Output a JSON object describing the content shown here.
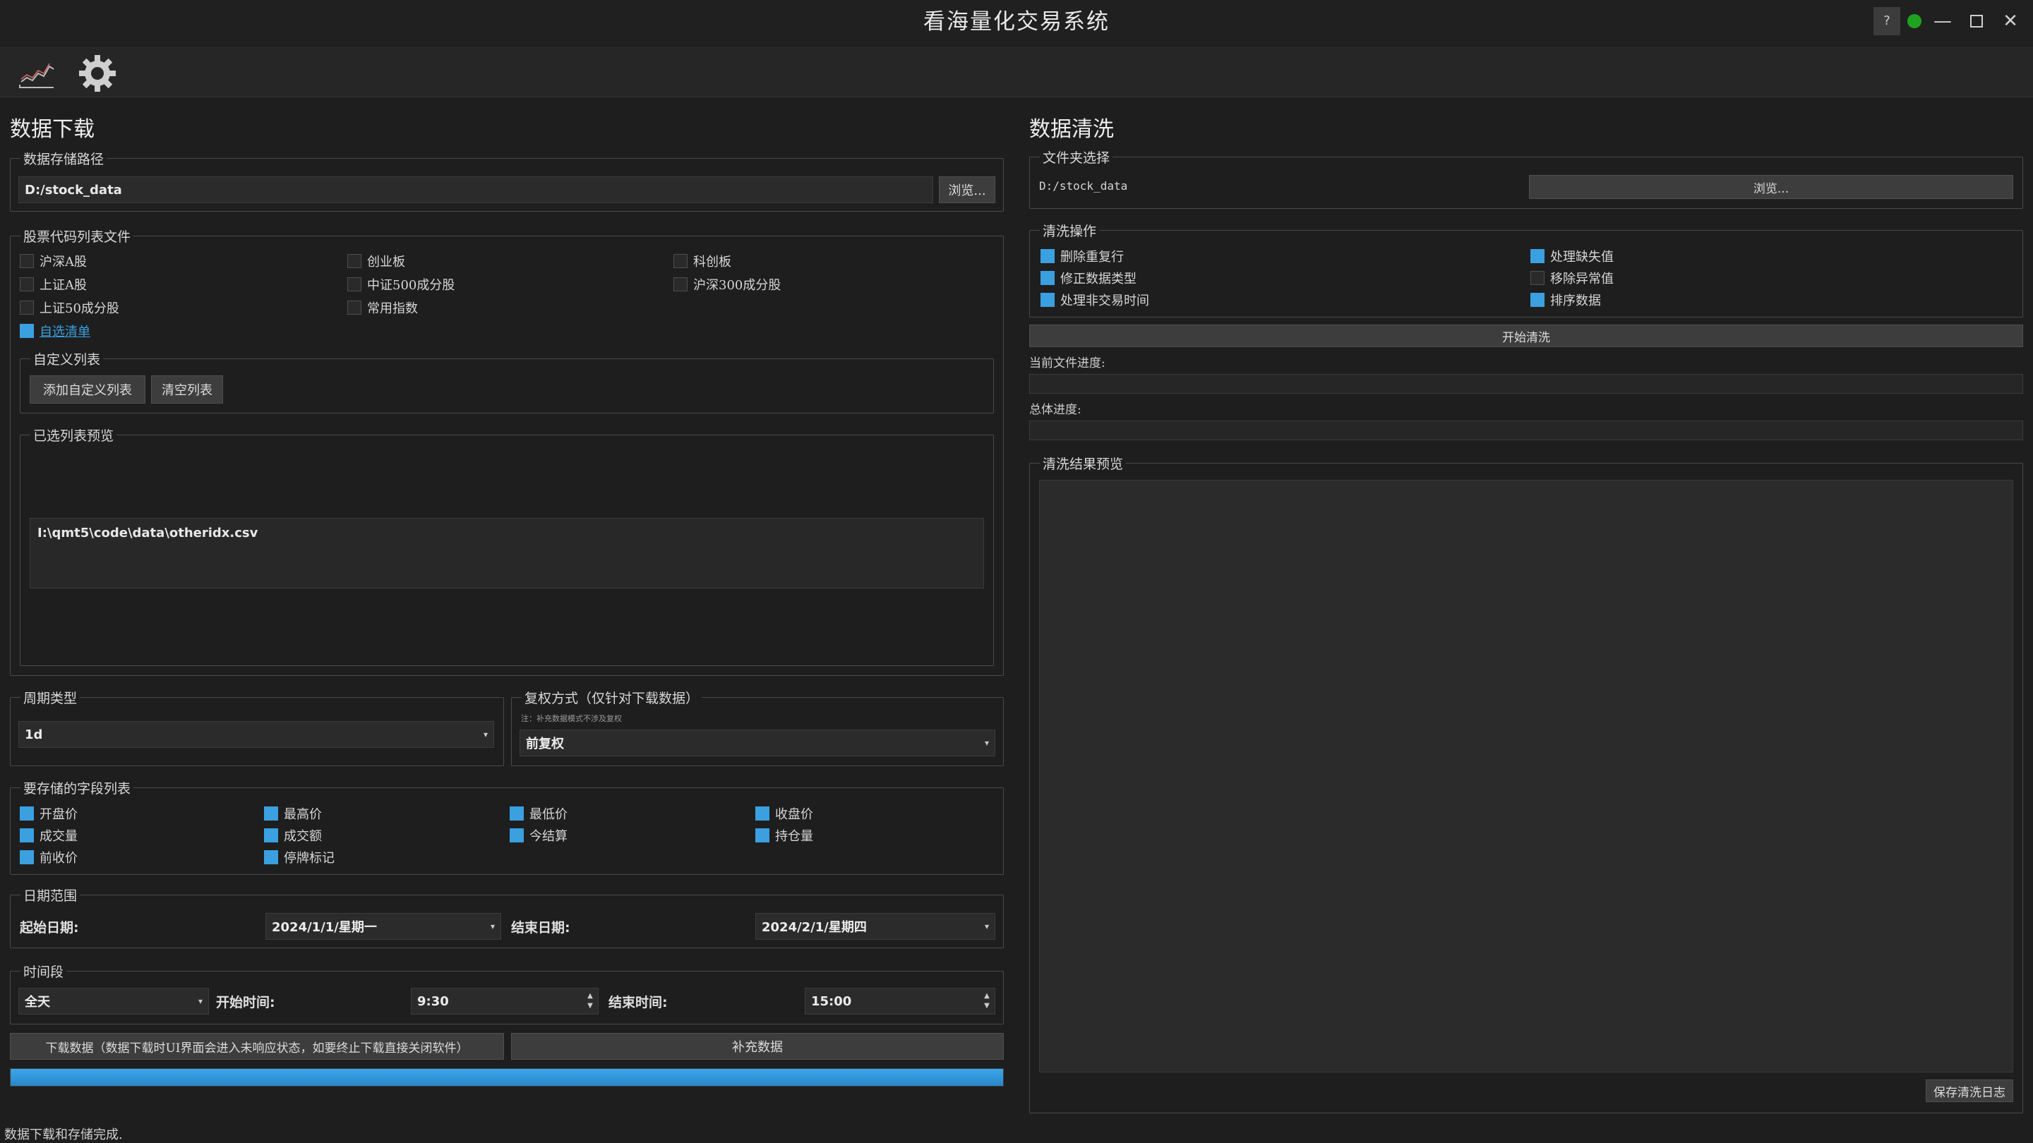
{
  "window": {
    "title": "看海量化交易系统",
    "help": "?",
    "status_color": "#1fa31f"
  },
  "left": {
    "title": "数据下载",
    "storage": {
      "label": "数据存储路径",
      "path": "D:/stock_data",
      "browse": "浏览..."
    },
    "codes": {
      "label": "股票代码列表文件",
      "items": [
        {
          "label": "沪深A股",
          "checked": false
        },
        {
          "label": "创业板",
          "checked": false
        },
        {
          "label": "科创板",
          "checked": false
        },
        {
          "label": "上证A股",
          "checked": false
        },
        {
          "label": "中证500成分股",
          "checked": false
        },
        {
          "label": "沪深300成分股",
          "checked": false
        },
        {
          "label": "上证50成分股",
          "checked": false
        },
        {
          "label": "常用指数",
          "checked": false
        }
      ],
      "custom_select": "自选清单"
    },
    "custom": {
      "label": "自定义列表",
      "add": "添加自定义列表",
      "clear": "清空列表"
    },
    "preview": {
      "label": "已选列表预览",
      "content": "I:\\qmt5\\code\\data\\otheridx.csv"
    },
    "period": {
      "label": "周期类型",
      "value": "1d"
    },
    "adjust": {
      "label": "复权方式（仅针对下载数据）",
      "note": "注：补充数据模式不涉及复权",
      "value": "前复权"
    },
    "fields": {
      "label": "要存储的字段列表",
      "items": [
        {
          "label": "开盘价",
          "checked": true
        },
        {
          "label": "最高价",
          "checked": true
        },
        {
          "label": "最低价",
          "checked": true
        },
        {
          "label": "收盘价",
          "checked": true
        },
        {
          "label": "成交量",
          "checked": true
        },
        {
          "label": "成交额",
          "checked": true
        },
        {
          "label": "今结算",
          "checked": true
        },
        {
          "label": "持仓量",
          "checked": true
        },
        {
          "label": "前收价",
          "checked": true
        },
        {
          "label": "停牌标记",
          "checked": true
        }
      ]
    },
    "date": {
      "label": "日期范围",
      "start_label": "起始日期:",
      "start": "2024/1/1/星期一",
      "end_label": "结束日期:",
      "end": "2024/2/1/星期四"
    },
    "time": {
      "label": "时间段",
      "mode": "全天",
      "start_label": "开始时间:",
      "start": "9:30",
      "end_label": "结束时间:",
      "end": "15:00"
    },
    "download": "下载数据（数据下载时UI界面会进入未响应状态，如要终止下载直接关闭软件）",
    "supplement": "补充数据",
    "progress": 100,
    "status": "数据下载和存储完成."
  },
  "right": {
    "title": "数据清洗",
    "folder": {
      "label": "文件夹选择",
      "path": "D:/stock_data",
      "browse": "浏览..."
    },
    "ops": {
      "label": "清洗操作",
      "items": [
        {
          "label": "删除重复行",
          "checked": true
        },
        {
          "label": "处理缺失值",
          "checked": true
        },
        {
          "label": "修正数据类型",
          "checked": true
        },
        {
          "label": "移除异常值",
          "checked": false
        },
        {
          "label": "处理非交易时间",
          "checked": true
        },
        {
          "label": "排序数据",
          "checked": true
        }
      ]
    },
    "start": "开始清洗",
    "current_label": "当前文件进度:",
    "current_progress": 0,
    "total_label": "总体进度:",
    "total_progress": 0,
    "result": {
      "label": "清洗结果预览",
      "save": "保存清洗日志"
    }
  }
}
